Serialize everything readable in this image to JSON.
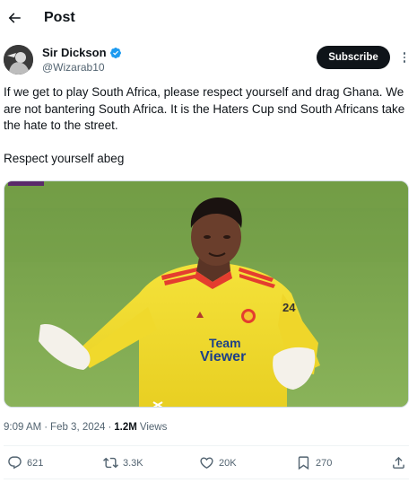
{
  "header": {
    "title": "Post"
  },
  "author": {
    "display_name": "Sir Dickson",
    "handle": "@Wizarab10",
    "verified": true
  },
  "subscribe_label": "Subscribe",
  "tweet": {
    "paragraphs": [
      "If we get to play South Africa, please respect yourself and drag Ghana. We are not bantering South Africa. It is the Haters Cup snd South Africans take the hate to the street.",
      "Respect yourself abeg"
    ]
  },
  "media": {
    "shirt_text": "TeamViewer",
    "shirt_text_line1": "Team",
    "shirt_text_line2": "Viewer",
    "colors": {
      "pitch": "#7fa84e",
      "kit": "#f2dc2e",
      "kit_accent": "#e43d2f"
    }
  },
  "meta": {
    "time": "9:09 AM",
    "separator": "·",
    "date": "Feb 3, 2024",
    "views_count": "1.2M",
    "views_label": "Views"
  },
  "actions": {
    "replies": "621",
    "reposts": "3.3K",
    "likes": "20K",
    "bookmarks": "270"
  },
  "colors": {
    "verified": "#1d9bf0",
    "text": "#0f1419",
    "secondary": "#536471"
  }
}
